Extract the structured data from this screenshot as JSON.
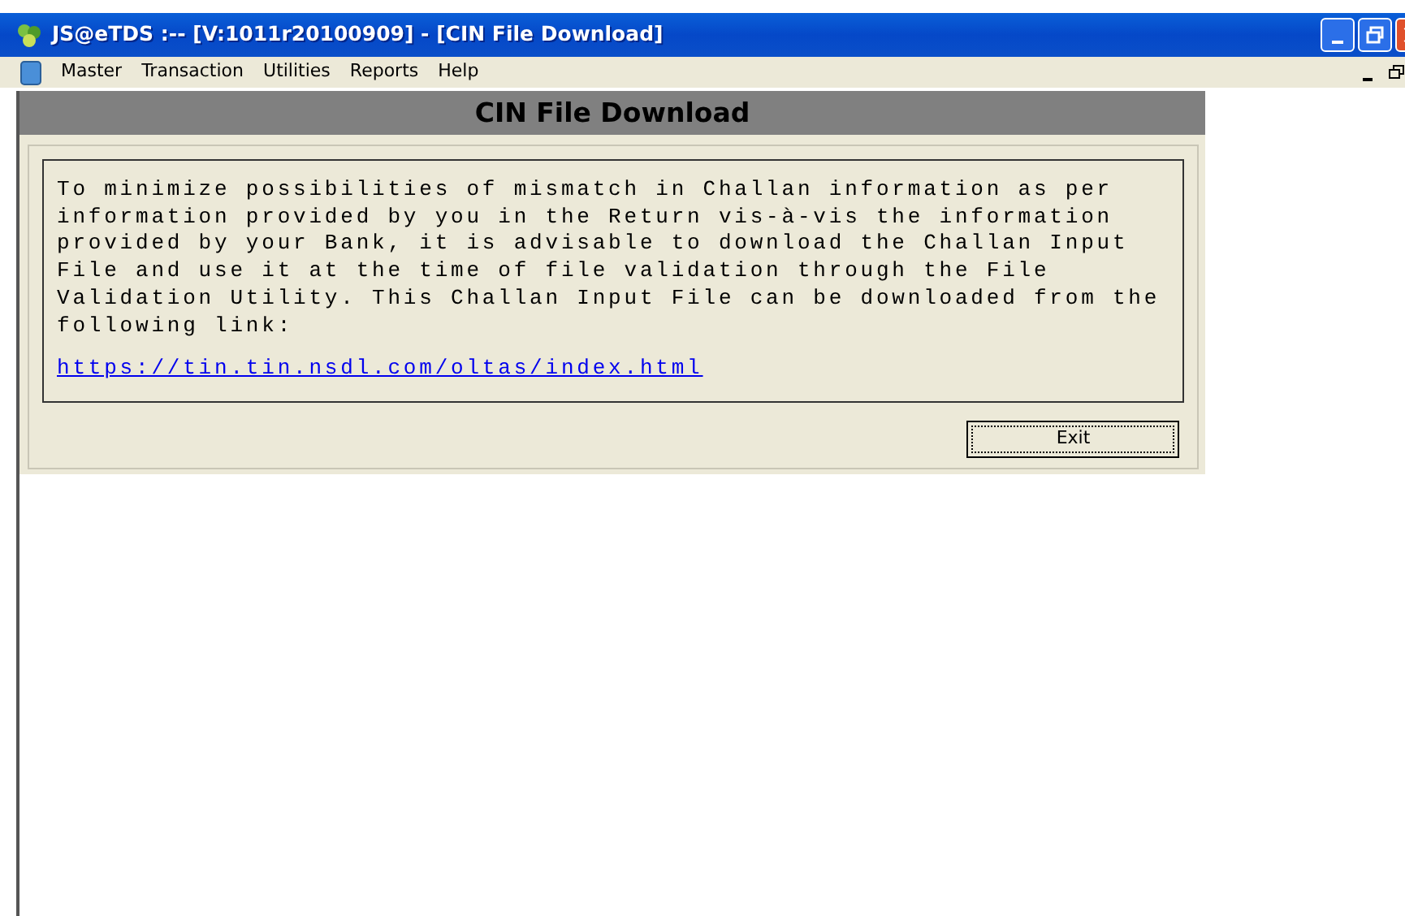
{
  "window": {
    "title": "JS@eTDS :--  [V:1011r20100909] - [CIN File Download]"
  },
  "menu": [
    {
      "label": "Master"
    },
    {
      "label": "Transaction"
    },
    {
      "label": "Utilities"
    },
    {
      "label": "Reports"
    },
    {
      "label": "Help"
    }
  ],
  "form": {
    "title": "CIN File Download",
    "message": "To minimize possibilities of mismatch in Challan information as per information provided by you in the Return vis-à-vis the information provided by your Bank, it is advisable to download the Challan Input File and use it at the time of file validation through the File Validation Utility. This Challan Input File can be downloaded from the following link:",
    "link": "https://tin.tin.nsdl.com/oltas/index.html",
    "buttons": [
      "Exit"
    ]
  }
}
